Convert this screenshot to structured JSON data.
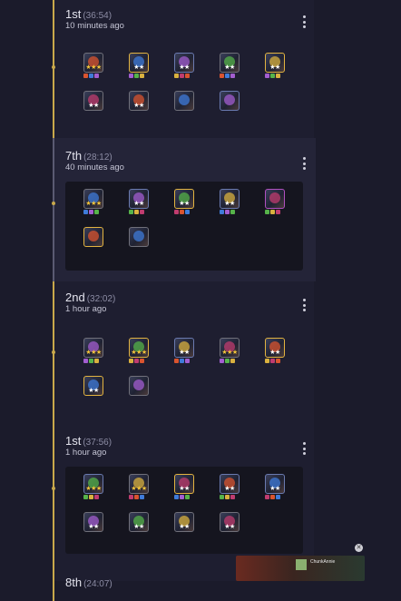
{
  "matches": [
    {
      "placement": "1st",
      "duration": "(36:54)",
      "ago": "10 minutes ago",
      "units": [
        {
          "stars": "★★★",
          "star_color": "gold",
          "frame": "c-grey"
        },
        {
          "stars": "★★",
          "star_color": "white",
          "frame": "c-gold"
        },
        {
          "stars": "★★",
          "star_color": "white",
          "frame": "c-blue"
        },
        {
          "stars": "★★",
          "star_color": "white",
          "frame": "c-grey"
        },
        {
          "stars": "★★",
          "star_color": "white",
          "frame": "c-gold"
        },
        {
          "stars": "★★",
          "star_color": "white",
          "frame": "c-grey"
        },
        {
          "stars": "★★",
          "star_color": "white",
          "frame": "c-grey"
        },
        {
          "stars": "",
          "star_color": "white",
          "frame": "c-grey"
        },
        {
          "stars": "",
          "star_color": "white",
          "frame": "c-blue"
        }
      ]
    },
    {
      "placement": "7th",
      "duration": "(28:12)",
      "ago": "40 minutes ago",
      "units": [
        {
          "stars": "★★★",
          "star_color": "gold",
          "frame": "c-grey"
        },
        {
          "stars": "★★",
          "star_color": "white",
          "frame": "c-blue"
        },
        {
          "stars": "★★",
          "star_color": "white",
          "frame": "c-gold"
        },
        {
          "stars": "★★",
          "star_color": "white",
          "frame": "c-blue"
        },
        {
          "stars": "",
          "star_color": "white",
          "frame": "c-purple"
        },
        {
          "stars": "",
          "star_color": "white",
          "frame": "c-gold"
        },
        {
          "stars": "",
          "star_color": "white",
          "frame": "c-grey"
        }
      ]
    },
    {
      "placement": "2nd",
      "duration": "(32:02)",
      "ago": "1 hour ago",
      "units": [
        {
          "stars": "★★★",
          "star_color": "gold",
          "frame": "c-grey"
        },
        {
          "stars": "★★★",
          "star_color": "gold",
          "frame": "c-gold"
        },
        {
          "stars": "★★",
          "star_color": "white",
          "frame": "c-blue"
        },
        {
          "stars": "★★★",
          "star_color": "gold",
          "frame": "c-grey"
        },
        {
          "stars": "★★",
          "star_color": "white",
          "frame": "c-gold"
        },
        {
          "stars": "★★",
          "star_color": "white",
          "frame": "c-gold"
        },
        {
          "stars": "",
          "star_color": "white",
          "frame": "c-grey"
        }
      ]
    },
    {
      "placement": "1st",
      "duration": "(37:56)",
      "ago": "1 hour ago",
      "units": [
        {
          "stars": "★★★",
          "star_color": "gold",
          "frame": "c-blue"
        },
        {
          "stars": "★★★",
          "star_color": "gold",
          "frame": "c-grey"
        },
        {
          "stars": "★★",
          "star_color": "white",
          "frame": "c-gold"
        },
        {
          "stars": "★★",
          "star_color": "white",
          "frame": "c-blue"
        },
        {
          "stars": "★★",
          "star_color": "white",
          "frame": "c-blue"
        },
        {
          "stars": "★★",
          "star_color": "white",
          "frame": "c-grey"
        },
        {
          "stars": "★★",
          "star_color": "white",
          "frame": "c-grey"
        },
        {
          "stars": "★★",
          "star_color": "white",
          "frame": "c-grey"
        },
        {
          "stars": "★★",
          "star_color": "white",
          "frame": "c-grey"
        }
      ]
    },
    {
      "placement": "8th",
      "duration": "(24:07)",
      "ago": "",
      "units": []
    }
  ],
  "video": {
    "title": "ChunkAnnie"
  },
  "colors": {
    "accent_gold": "#c8a84b",
    "star_gold": "#f3c43a",
    "bg": "#1b1b2b"
  },
  "icons": {
    "menu": "kebab-menu-icon",
    "close": "close-icon"
  }
}
